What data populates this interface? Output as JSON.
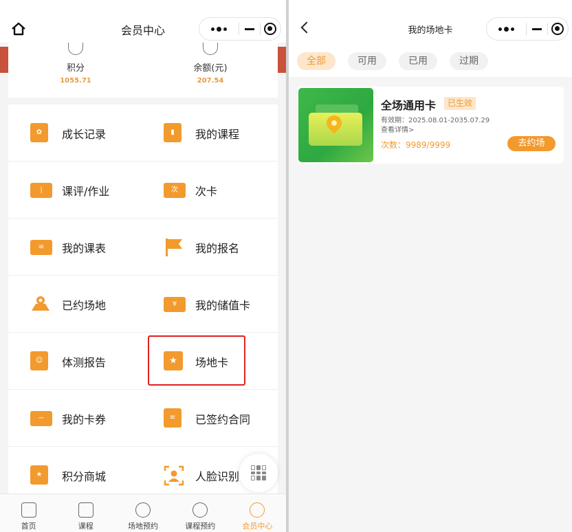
{
  "left": {
    "nav_title": "会员中心",
    "stats": [
      {
        "label": "积分",
        "value": "1055.71",
        "icon": "coin-stack-icon"
      },
      {
        "label": "余额(元)",
        "value": "207.54",
        "icon": "yuan-coin-icon"
      }
    ],
    "menu": [
      [
        {
          "label": "成长记录",
          "icon": "growth-record-icon"
        },
        {
          "label": "我的课程",
          "icon": "course-book-icon"
        }
      ],
      [
        {
          "label": "课评/作业",
          "icon": "open-book-icon"
        },
        {
          "label": "次卡",
          "icon": "punch-card-icon",
          "glyph": "次"
        }
      ],
      [
        {
          "label": "我的课表",
          "icon": "timetable-icon"
        },
        {
          "label": "我的报名",
          "icon": "flag-icon"
        }
      ],
      [
        {
          "label": "已约场地",
          "icon": "venue-map-icon"
        },
        {
          "label": "我的储值卡",
          "icon": "stored-value-card-icon",
          "glyph": "¥"
        }
      ],
      [
        {
          "label": "体测报告",
          "icon": "fitness-report-icon"
        },
        {
          "label": "场地卡",
          "icon": "star-card-icon",
          "glyph": "★"
        }
      ],
      [
        {
          "label": "我的卡券",
          "icon": "coupon-icon"
        },
        {
          "label": "已签约合同",
          "icon": "contract-icon"
        }
      ],
      [
        {
          "label": "积分商城",
          "icon": "points-mall-icon"
        },
        {
          "label": "人脸识别",
          "icon": "face-recognition-icon"
        }
      ]
    ],
    "tabs": [
      {
        "label": "首页",
        "icon": "home-icon",
        "active": false
      },
      {
        "label": "课程",
        "icon": "bag-icon",
        "active": false
      },
      {
        "label": "场地预约",
        "icon": "venue-icon",
        "active": false
      },
      {
        "label": "课程预约",
        "icon": "clock-icon",
        "active": false
      },
      {
        "label": "会员中心",
        "icon": "user-icon",
        "active": true
      }
    ]
  },
  "right": {
    "nav_title": "我的场地卡",
    "filters": [
      {
        "label": "全部",
        "active": true
      },
      {
        "label": "可用",
        "active": false
      },
      {
        "label": "已用",
        "active": false
      },
      {
        "label": "过期",
        "active": false
      }
    ],
    "card": {
      "title": "全场通用卡",
      "status": "已生效",
      "validity": "有效期：2025.08.01-2035.07.29",
      "detail_link": "查看详情>",
      "count": "次数：9989/9999",
      "action": "去约场"
    }
  },
  "colors": {
    "accent": "#f29a2e",
    "highlight": "#e02020",
    "card_green": "#3fb84a"
  }
}
